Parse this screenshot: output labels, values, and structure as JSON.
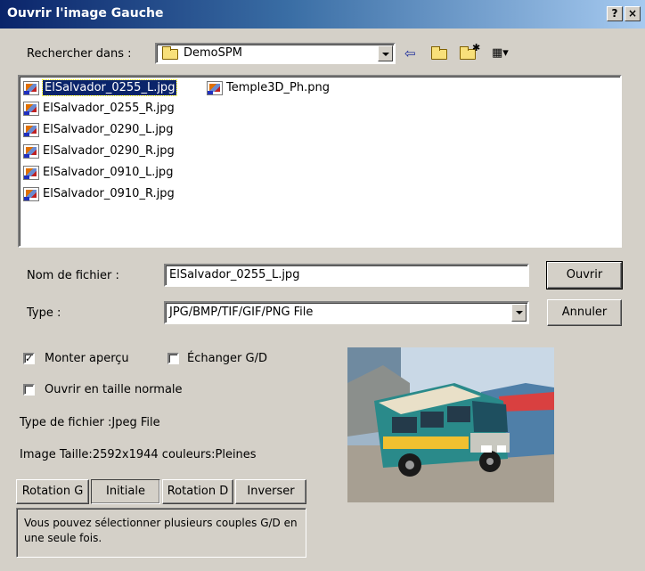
{
  "window": {
    "title": "Ouvrir l'image Gauche",
    "help_label": "?",
    "close_label": "×"
  },
  "lookin": {
    "label": "Rechercher dans :",
    "value": "DemoSPM"
  },
  "files": [
    {
      "name": "ElSalvador_0255_L.jpg"
    },
    {
      "name": "ElSalvador_0255_R.jpg"
    },
    {
      "name": "ElSalvador_0290_L.jpg"
    },
    {
      "name": "ElSalvador_0290_R.jpg"
    },
    {
      "name": "ElSalvador_0910_L.jpg"
    },
    {
      "name": "ElSalvador_0910_R.jpg"
    },
    {
      "name": "Temple3D_Ph.png"
    }
  ],
  "filename": {
    "label": "Nom de fichier :",
    "value": "ElSalvador_0255_L.jpg"
  },
  "filetype": {
    "label": "Type :",
    "value": "JPG/BMP/TIF/GIF/PNG File"
  },
  "buttons": {
    "open": "Ouvrir",
    "cancel": "Annuler",
    "rotate_left": "Rotation G",
    "initial": "Initiale",
    "rotate_right": "Rotation D",
    "invert": "Inverser"
  },
  "options": {
    "show_preview": "Monter aperçu",
    "show_preview_checked": true,
    "swap_lr": "Échanger G/D",
    "swap_lr_checked": false,
    "open_normal_size": "Ouvrir en taille normale",
    "open_normal_size_checked": false
  },
  "info": {
    "file_type": "Type de fichier :Jpeg File",
    "image_size": "Image Taille:2592x1944  couleurs:Pleines"
  },
  "message": "Vous pouvez sélectionner plusieurs couples G/D en une seule fois.",
  "colors": {
    "title_start": "#0a246a",
    "title_end": "#a6caf0",
    "selection": "#0a246a",
    "dialog_bg": "#d4d0c8"
  }
}
